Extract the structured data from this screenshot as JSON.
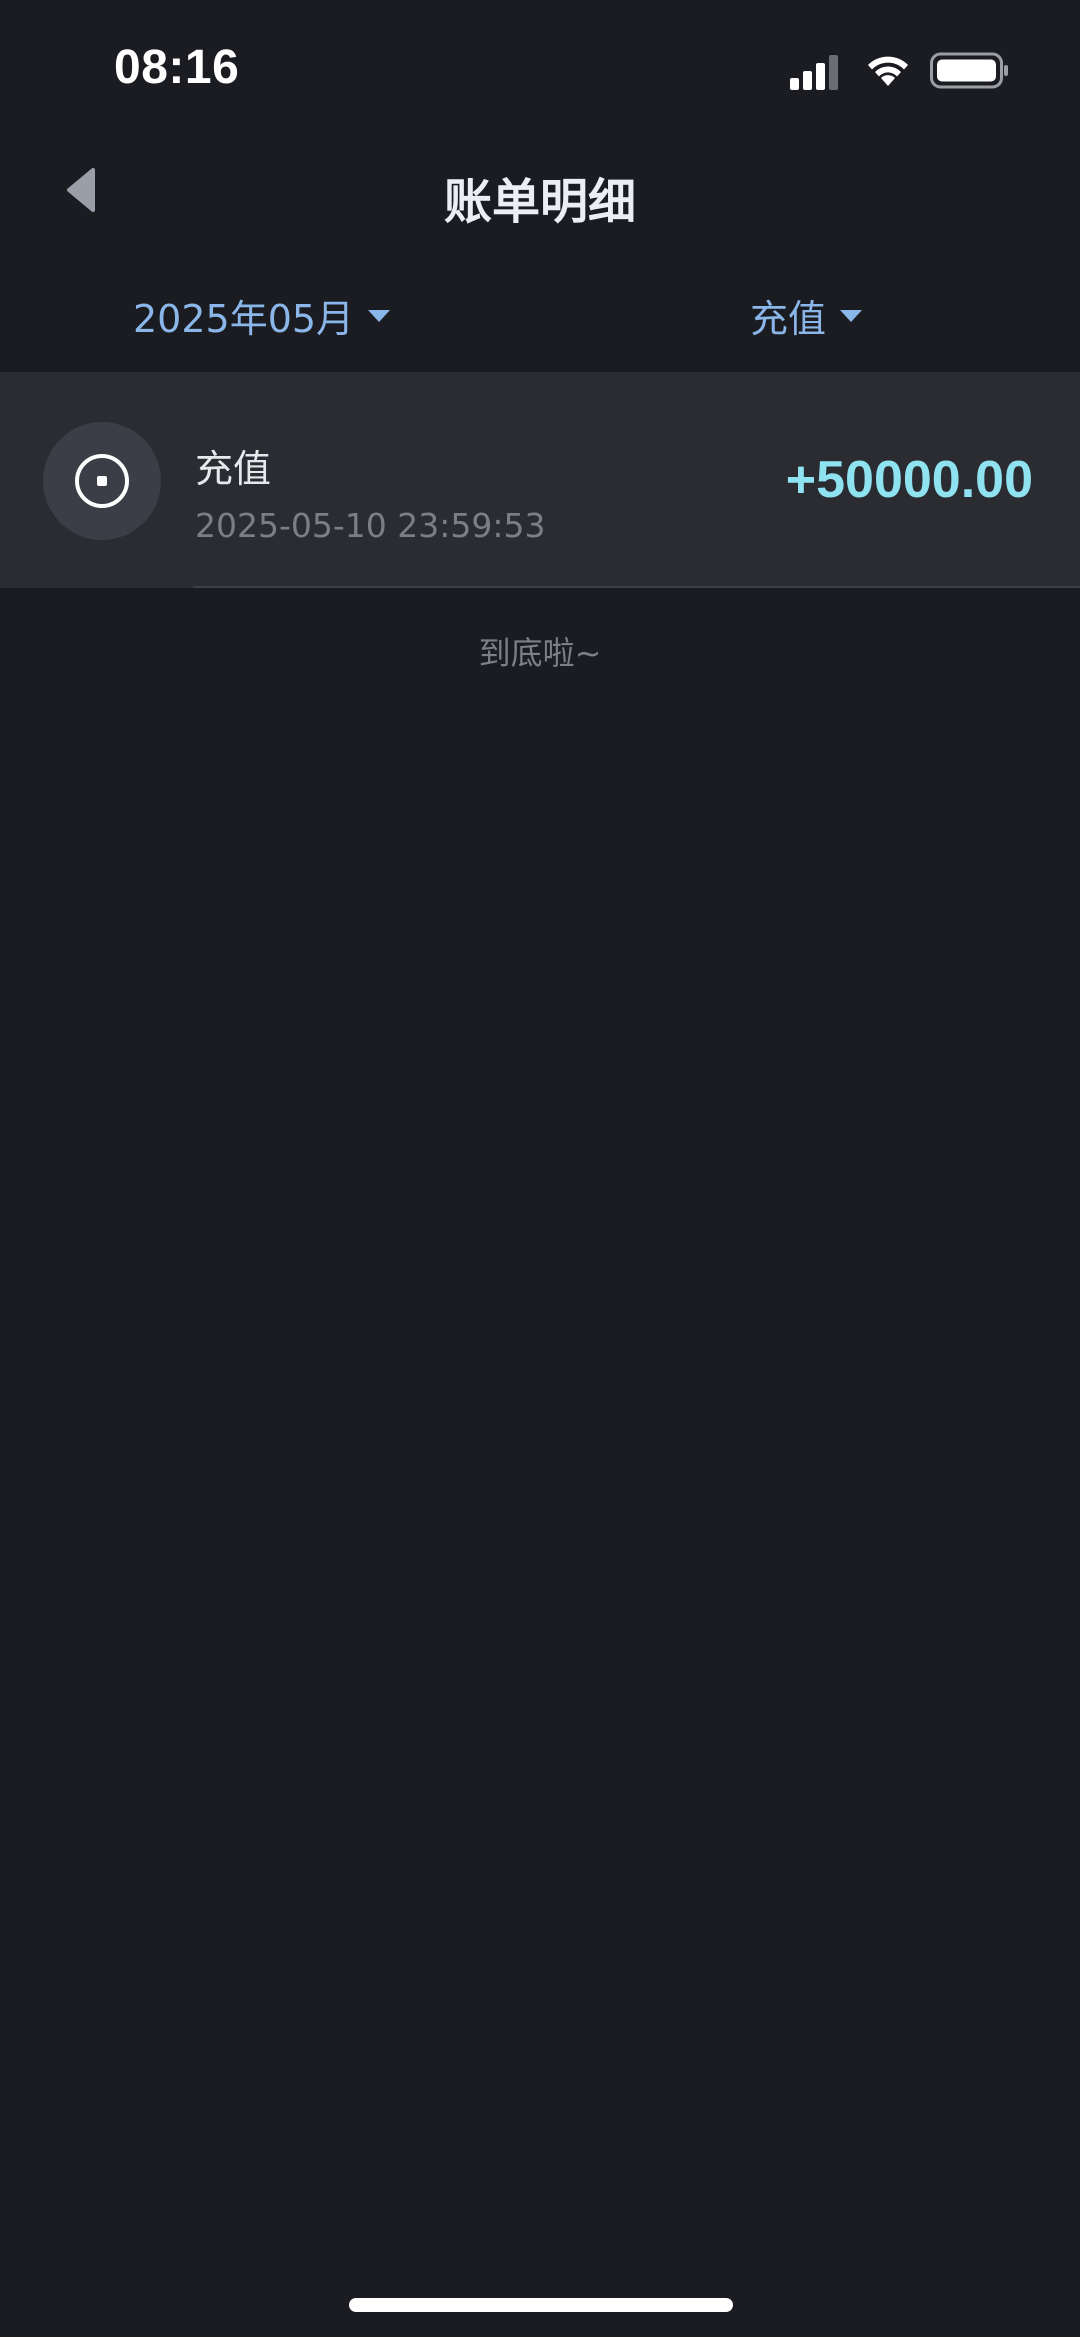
{
  "status_bar": {
    "time": "08:16"
  },
  "header": {
    "title": "账单明细"
  },
  "filters": {
    "date_label": "2025年05月",
    "type_label": "充值"
  },
  "bills": [
    {
      "title": "充值",
      "time": "2025-05-10 23:59:53",
      "amount": "+50000.00"
    }
  ],
  "end_hint": "到底啦~",
  "colors": {
    "background": "#1b1c21",
    "row_background": "#2a2c32",
    "accent_blue": "#8ab6ea",
    "amount_color": "#8fe2ef"
  },
  "icons": {
    "back": "back-arrow-icon",
    "record": "record-icon",
    "signal": "signal-icon",
    "wifi": "wifi-icon",
    "battery": "battery-icon"
  }
}
